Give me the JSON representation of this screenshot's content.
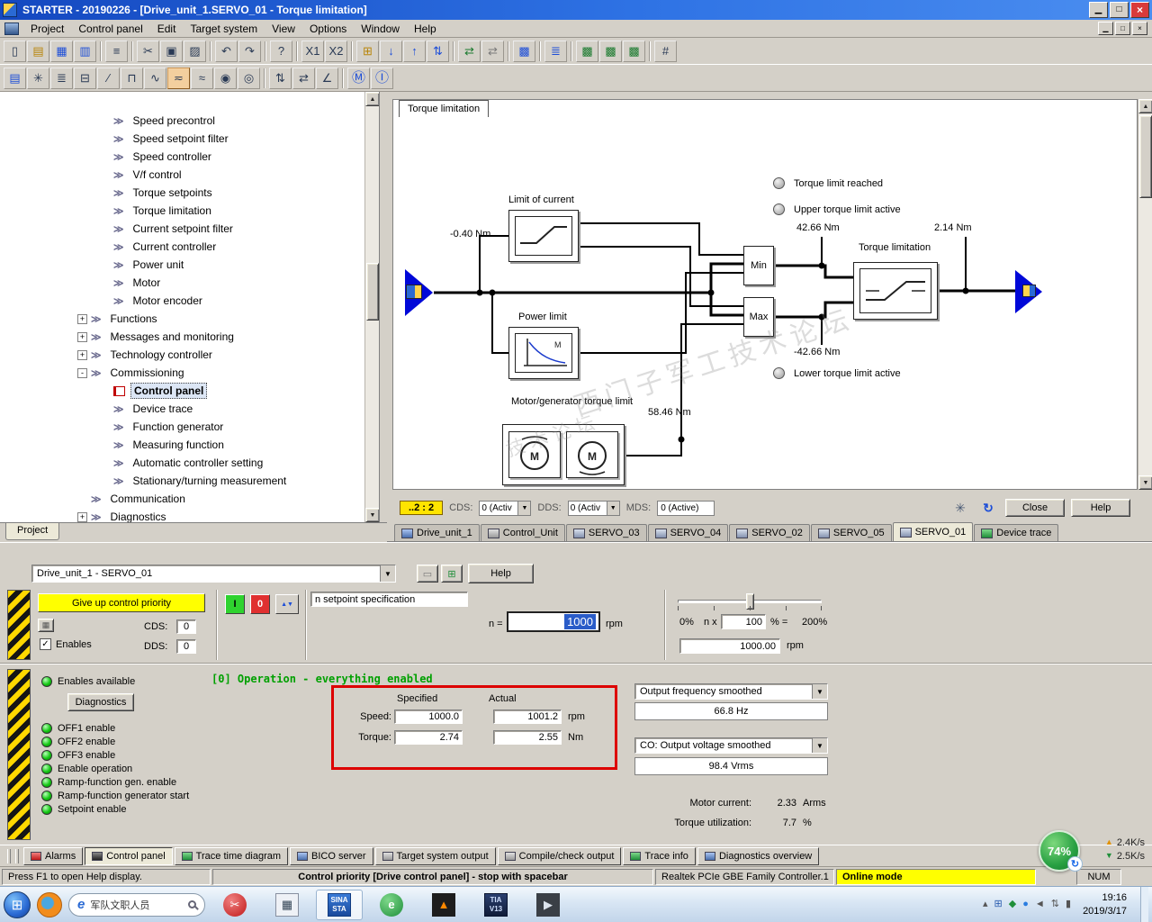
{
  "window": {
    "title": "STARTER - 20190226 - [Drive_unit_1.SERVO_01 - Torque limitation]",
    "buttons": {
      "minimize": "▁",
      "restore": "□",
      "close": "×"
    }
  },
  "icons": {
    "dropdown": "▼",
    "up": "▲",
    "down": "▼",
    "check": "✓",
    "gear": "✳",
    "refresh": "↻",
    "jog": "▲▼",
    "start_flag": "⊞",
    "net_up": "▲",
    "net_down": "▼",
    "battery_refresh": "↻"
  },
  "menu": {
    "items": [
      "Project",
      "Control panel",
      "Edit",
      "Target system",
      "View",
      "Options",
      "Window",
      "Help"
    ]
  },
  "toolbar_main": {
    "buttons": [
      {
        "name": "new-project-icon",
        "glyph": "▯"
      },
      {
        "name": "open-project-icon",
        "glyph": "▤",
        "variant": "amber"
      },
      {
        "name": "save-project-icon",
        "glyph": "▦",
        "variant": "blue"
      },
      {
        "name": "save-archive-icon",
        "glyph": "▥",
        "variant": "blue"
      },
      {
        "sep": true
      },
      {
        "name": "print-icon",
        "glyph": "≡"
      },
      {
        "sep": true
      },
      {
        "name": "cut-icon",
        "glyph": "✂"
      },
      {
        "name": "copy-icon",
        "glyph": "▣"
      },
      {
        "name": "paste-icon",
        "glyph": "▨"
      },
      {
        "sep": true
      },
      {
        "name": "undo-icon",
        "glyph": "↶"
      },
      {
        "name": "redo-icon",
        "glyph": "↷"
      },
      {
        "sep": true
      },
      {
        "name": "context-help-icon",
        "glyph": "?"
      },
      {
        "sep": true
      },
      {
        "name": "zoom-x1-icon",
        "glyph": "X1"
      },
      {
        "name": "zoom-x2-icon",
        "glyph": "X2"
      },
      {
        "sep": true
      },
      {
        "name": "accessible-nodes-icon",
        "glyph": "⊞",
        "variant": "amber"
      },
      {
        "name": "download-to-target-icon",
        "glyph": "↓",
        "variant": "blue"
      },
      {
        "name": "upload-to-pg-icon",
        "glyph": "↑",
        "variant": "blue"
      },
      {
        "name": "copy-ram-to-rom-icon",
        "glyph": "⇅",
        "variant": "blue"
      },
      {
        "sep": true
      },
      {
        "name": "connect-target-icon",
        "glyph": "⇄",
        "variant": "green"
      },
      {
        "name": "disconnect-target-icon",
        "glyph": "⇄",
        "variant": "gray"
      },
      {
        "sep": true
      },
      {
        "name": "show-outputs-icon",
        "glyph": "▩",
        "variant": "blue"
      },
      {
        "sep": true
      },
      {
        "name": "user-management-icon",
        "glyph": "≣",
        "variant": "blue"
      },
      {
        "sep": true
      },
      {
        "name": "trace-window-icon",
        "glyph": "▩",
        "variant": "green"
      },
      {
        "name": "measuring-window-icon",
        "glyph": "▩",
        "variant": "green"
      },
      {
        "name": "function-generator-window-icon",
        "glyph": "▩",
        "variant": "green"
      },
      {
        "sep": true
      },
      {
        "name": "topology-icon",
        "glyph": "#"
      }
    ]
  },
  "toolbar_drive": {
    "buttons": [
      {
        "name": "drive-navigator-icon",
        "glyph": "▤",
        "variant": "blue"
      },
      {
        "name": "configuration-icon",
        "glyph": "✳"
      },
      {
        "name": "expert-list-icon",
        "glyph": "≣"
      },
      {
        "name": "terminals-icon",
        "glyph": "⊟"
      },
      {
        "name": "ramp-generator-icon",
        "glyph": "∕"
      },
      {
        "name": "setpoint-channel-icon",
        "glyph": "⊓"
      },
      {
        "name": "speed-controller-icon",
        "glyph": "∿"
      },
      {
        "name": "torque-limitation-icon",
        "glyph": "≂",
        "variant": "hot"
      },
      {
        "name": "current-controller-icon",
        "glyph": "≈"
      },
      {
        "name": "motor-data-icon",
        "glyph": "◉"
      },
      {
        "name": "encoder-data-icon",
        "glyph": "◎"
      },
      {
        "sep": true
      },
      {
        "name": "inputs-outputs-icon",
        "glyph": "⇅"
      },
      {
        "name": "communication-icon",
        "glyph": "⇄"
      },
      {
        "name": "diagnostics-tool-icon",
        "glyph": "∠"
      },
      {
        "sep": true
      },
      {
        "name": "motor-module-icon",
        "glyph": "Ⓜ",
        "variant": "circle"
      },
      {
        "name": "infeed-icon",
        "glyph": "Ⓘ",
        "variant": "circle"
      }
    ]
  },
  "project_tree": {
    "bottom_tab": "Project",
    "items": [
      {
        "label": "Speed precontrol",
        "level": 3
      },
      {
        "label": "Speed setpoint filter",
        "level": 3
      },
      {
        "label": "Speed controller",
        "level": 3
      },
      {
        "label": "V/f control",
        "level": 3
      },
      {
        "label": "Torque setpoints",
        "level": 3
      },
      {
        "label": "Torque limitation",
        "level": 3
      },
      {
        "label": "Current setpoint filter",
        "level": 3
      },
      {
        "label": "Current controller",
        "level": 3
      },
      {
        "label": "Power unit",
        "level": 3
      },
      {
        "label": "Motor",
        "level": 3
      },
      {
        "label": "Motor encoder",
        "level": 3
      },
      {
        "label": "Functions",
        "level": 2,
        "expand": "+"
      },
      {
        "label": "Messages and monitoring",
        "level": 2,
        "expand": "+"
      },
      {
        "label": "Technology controller",
        "level": 2,
        "expand": "+"
      },
      {
        "label": "Commissioning",
        "level": 2,
        "expand": "-"
      },
      {
        "label": "Control panel",
        "level": 3,
        "selected": true,
        "icon": "panel"
      },
      {
        "label": "Device trace",
        "level": 3
      },
      {
        "label": "Function generator",
        "level": 3
      },
      {
        "label": "Measuring function",
        "level": 3
      },
      {
        "label": "Automatic controller setting",
        "level": 3
      },
      {
        "label": "Stationary/turning measurement",
        "level": 3
      },
      {
        "label": "Communication",
        "level": 2
      },
      {
        "label": "Diagnostics",
        "level": 2,
        "expand": "+"
      }
    ]
  },
  "diagram": {
    "tab_label": "Torque limitation",
    "status": [
      "Torque limit reached",
      "Upper torque limit active",
      "Lower torque limit active"
    ],
    "labels": {
      "limit_of_current": "Limit of current",
      "power_limit": "Power limit",
      "motor_generator": "Motor/generator torque limit",
      "torque_limitation_block": "Torque limitation",
      "min": "Min",
      "max": "Max",
      "motor_letter": "M"
    },
    "values": {
      "input": "-0.40 Nm",
      "upper": "42.66 Nm",
      "output": "2.14 Nm",
      "lower": "-42.66 Nm",
      "motor_generator": "58.46 Nm"
    },
    "footer": {
      "badge": "..2 : 2",
      "cds_label": "CDS:",
      "cds_value": "0 (Activ",
      "dds_label": "DDS:",
      "dds_value": "0 (Activ",
      "mds_label": "MDS:",
      "mds_value": "0 (Active)",
      "close": "Close",
      "help": "Help"
    }
  },
  "drive_tabs": {
    "tabs": [
      {
        "label": "Drive_unit_1",
        "icon": "drive-unit-icon",
        "variant": "blue"
      },
      {
        "label": "Control_Unit",
        "icon": "control-unit-icon",
        "variant": "gray"
      },
      {
        "label": "SERVO_03",
        "icon": "servo-icon",
        "variant": "servo"
      },
      {
        "label": "SERVO_04",
        "icon": "servo-icon",
        "variant": "servo"
      },
      {
        "label": "SERVO_02",
        "icon": "servo-icon",
        "variant": "servo"
      },
      {
        "label": "SERVO_05",
        "icon": "servo-icon",
        "variant": "servo"
      },
      {
        "label": "SERVO_01",
        "icon": "servo-icon",
        "variant": "servo",
        "active": true
      },
      {
        "label": "Device trace",
        "icon": "device-trace-icon",
        "variant": "green"
      }
    ]
  },
  "control_panel": {
    "drive_selector": "Drive_unit_1 - SERVO_01",
    "btn_icons": [
      {
        "glyph": "▭"
      },
      {
        "glyph": "⊞"
      }
    ],
    "help_button": "Help",
    "give_up_button": "Give up control priority",
    "cds_label": "CDS:",
    "cds_value": "0",
    "dds_label": "DDS:",
    "dds_value": "0",
    "enables_label": "Enables",
    "on_button": "I",
    "off_button": "0",
    "setpoint_spec": "n setpoint specification",
    "n_label": "n =",
    "n_value": "1000",
    "n_unit": "rpm",
    "slider": {
      "left": "0%",
      "right": "200%",
      "nx": "n x",
      "pct_value": "100",
      "pct_eq": "% =",
      "result": "1000.00",
      "result_unit": "rpm"
    },
    "status_text": "[0] Operation - everything enabled",
    "diagnostics_button": "Diagnostics",
    "enables_available": "Enables available",
    "leds": [
      "OFF1 enable",
      "OFF2 enable",
      "OFF3 enable",
      "Enable operation",
      "Ramp-function gen. enable",
      "Ramp-function generator start",
      "Setpoint enable"
    ],
    "comparison": {
      "col_specified": "Specified",
      "col_actual": "Actual",
      "rows": [
        {
          "label": "Speed:",
          "specified": "1000.0",
          "actual": "1001.2",
          "unit": "rpm"
        },
        {
          "label": "Torque:",
          "specified": "2.74",
          "actual": "2.55",
          "unit": "Nm"
        }
      ]
    },
    "signal1": {
      "name": "Output frequency smoothed",
      "value": "66.8 Hz"
    },
    "signal2": {
      "name": "CO: Output voltage smoothed",
      "value": "98.4 Vrms"
    },
    "motor_current_label": "Motor current:",
    "motor_current_value": "2.33",
    "motor_current_unit": "Arms",
    "torque_util_label": "Torque utilization:",
    "torque_util_value": "7.7",
    "torque_util_unit": "%"
  },
  "bottom_tabs": {
    "tabs": [
      {
        "label": "Alarms",
        "icon": "alarms-icon",
        "variant": "red"
      },
      {
        "label": "Control panel",
        "icon": "control-panel-icon",
        "variant": "dark",
        "active": true
      },
      {
        "label": "Trace time diagram",
        "icon": "trace-time-icon",
        "variant": "green"
      },
      {
        "label": "BICO server",
        "icon": "bico-server-icon",
        "variant": "blue"
      },
      {
        "label": "Target system output",
        "icon": "target-output-icon",
        "variant": "gray"
      },
      {
        "label": "Compile/check output",
        "icon": "compile-output-icon",
        "variant": "gray"
      },
      {
        "label": "Trace info",
        "icon": "trace-info-icon",
        "variant": "green"
      },
      {
        "label": "Diagnostics overview",
        "icon": "diagnostics-overview-icon",
        "variant": "blue"
      }
    ]
  },
  "status_bar": {
    "help_hint": "Press F1 to open Help display.",
    "priority": "Control priority [Drive control panel] - stop with spacebar",
    "network": "Realtek PCIe GBE Family Controller.1",
    "mode": "Online mode",
    "num": "NUM"
  },
  "overlay": {
    "battery_pct": "74%",
    "net_up": "2.4K/s",
    "net_down": "2.5K/s"
  },
  "taskbar": {
    "search_text": "军队文职人员",
    "apps": [
      {
        "name": "taskbar-app-snipping",
        "style": "redc",
        "glyph": "✂"
      },
      {
        "name": "taskbar-app-calculator",
        "style": "calc",
        "glyph": "▦"
      },
      {
        "name": "taskbar-app-starter",
        "style": "sina",
        "line1": "SINA",
        "line2": "STA",
        "active": true
      },
      {
        "name": "taskbar-app-browser-green",
        "style": "greenc",
        "glyph": "e"
      },
      {
        "name": "taskbar-app-nx",
        "style": "dark",
        "glyph": "▲"
      },
      {
        "name": "taskbar-app-tia-portal",
        "style": "tia",
        "line1": "TIA",
        "line2": "V13"
      },
      {
        "name": "taskbar-app-cad",
        "style": "dark2",
        "glyph": "▶"
      }
    ],
    "tray": [
      {
        "name": "tray-show-hidden-icon",
        "glyph": "▴",
        "color": "#555555"
      },
      {
        "name": "tray-ime-icon",
        "glyph": "⊞",
        "color": "#2a5db0"
      },
      {
        "name": "tray-safety-icon",
        "glyph": "◆",
        "color": "#1f8f3a"
      },
      {
        "name": "tray-cloud-icon",
        "glyph": "●",
        "color": "#2a7de0"
      },
      {
        "name": "tray-sound-icon",
        "glyph": "◄",
        "color": "#555555"
      },
      {
        "name": "tray-usb-icon",
        "glyph": "⇅",
        "color": "#555555"
      },
      {
        "name": "tray-network-icon",
        "glyph": "▮",
        "color": "#555555"
      }
    ],
    "clock": {
      "time": "19:16",
      "date": "2019/3/17"
    }
  },
  "watermark": {
    "line1": "西门子军工技术论坛",
    "line2": "技术论坛"
  }
}
